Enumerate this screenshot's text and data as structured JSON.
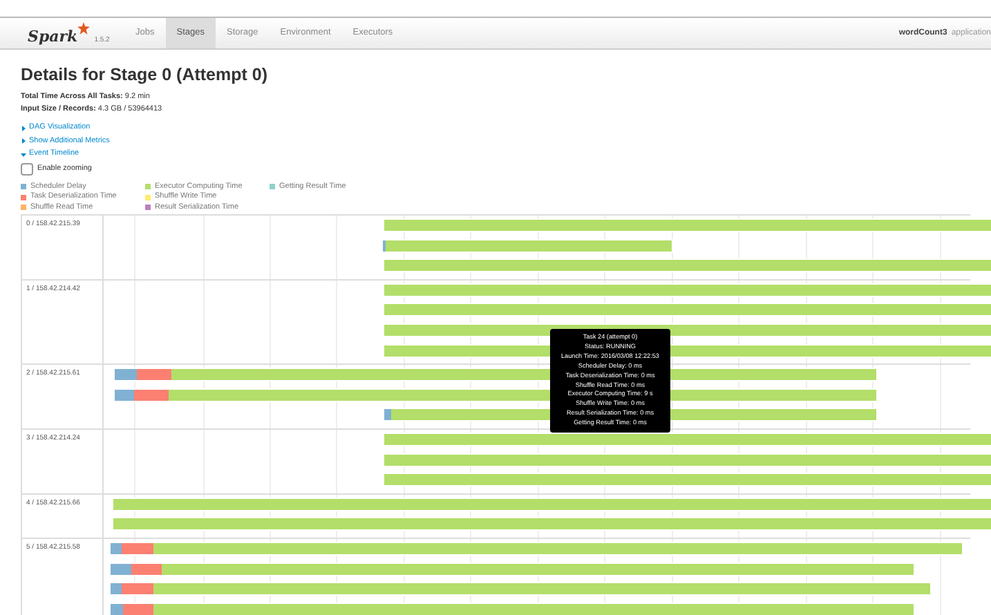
{
  "navbar": {
    "logo": "Spark",
    "version": "1.5.2",
    "tabs": [
      {
        "label": "Jobs",
        "selected": false
      },
      {
        "label": "Stages",
        "selected": true
      },
      {
        "label": "Storage",
        "selected": false
      },
      {
        "label": "Environment",
        "selected": false
      },
      {
        "label": "Executors",
        "selected": false
      }
    ],
    "app_name": "wordCount3",
    "app_suffix": "application"
  },
  "title": "Details for Stage 0 (Attempt 0)",
  "summary": [
    {
      "label": "Total Time Across All Tasks:",
      "value": "9.2 min"
    },
    {
      "label": "Input Size / Records:",
      "value": "4.3 GB / 53964413"
    }
  ],
  "links": [
    {
      "label": "DAG Visualization",
      "expanded": false
    },
    {
      "label": "Show Additional Metrics",
      "expanded": false
    },
    {
      "label": "Event Timeline",
      "expanded": true
    }
  ],
  "zoom_checkbox": {
    "label": "Enable zooming",
    "checked": false
  },
  "legend": [
    {
      "label": "Scheduler Delay",
      "color": "#80b1d3"
    },
    {
      "label": "Task Deserialization Time",
      "color": "#fb8072"
    },
    {
      "label": "Shuffle Read Time",
      "color": "#fdb462"
    },
    {
      "label": "Executor Computing Time",
      "color": "#b3de69"
    },
    {
      "label": "Shuffle Write Time",
      "color": "#ffed6f"
    },
    {
      "label": "Result Serialization Time",
      "color": "#bc80bd"
    },
    {
      "label": "Getting Result Time",
      "color": "#8dd3c7"
    }
  ],
  "executors": [
    {
      "label": "0 / 158.42.215.39"
    },
    {
      "label": "1 / 158.42.214.42"
    },
    {
      "label": "2 / 158.42.215.61"
    },
    {
      "label": "3 / 158.42.214.24"
    },
    {
      "label": "4 / 158.42.215.66"
    },
    {
      "label": "5 / 158.42.215.58"
    }
  ],
  "tooltip": {
    "lines": [
      "Task 24 (attempt 0)",
      "Status: RUNNING",
      "Launch Time: 2016/03/08 12:22:53",
      "Scheduler Delay: 0 ms",
      "Task Deserialization Time: 0 ms",
      "Shuffle Read Time: 0 ms",
      "Executor Computing Time: 9 s",
      "Shuffle Write Time: 0 ms",
      "Result Serialization Time: 0 ms",
      "Getting Result Time: 0 ms"
    ]
  }
}
